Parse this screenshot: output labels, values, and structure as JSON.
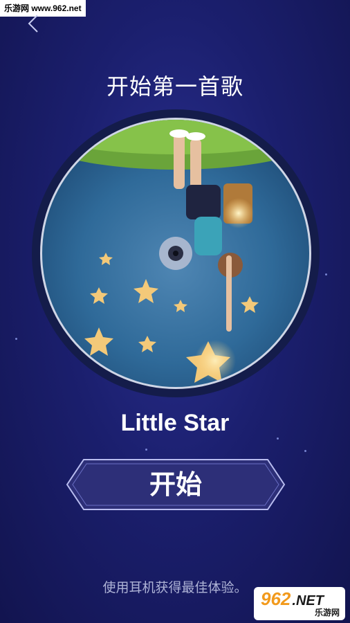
{
  "watermark": {
    "top_text": "乐游网 www.962.net",
    "logo_main": "962",
    "logo_net": ".NET",
    "logo_sub": "乐游网"
  },
  "header": {
    "back_icon": "chevron-left-icon"
  },
  "title": "开始第一首歌",
  "song": {
    "name": "Little Star"
  },
  "start_button": {
    "label": "开始"
  },
  "hint": "使用耳机获得最佳体验。",
  "colors": {
    "bg_top": "#2a2f8f",
    "bg_bottom": "#12144f",
    "button_fill": "#2d2f78",
    "button_border": "#b9bdf0",
    "hint": "#aeb3d6",
    "watermark_orange": "#f29a1c"
  }
}
